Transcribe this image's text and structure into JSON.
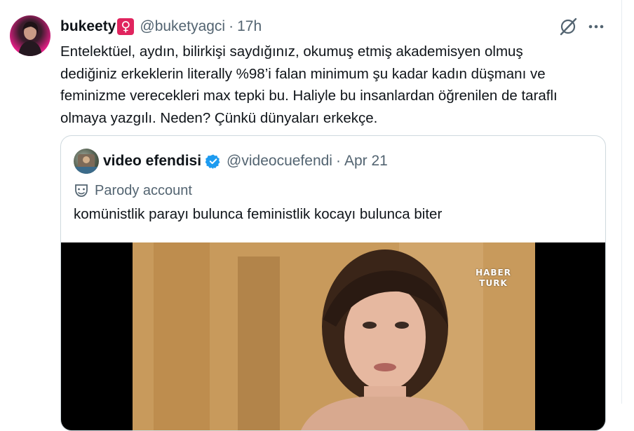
{
  "tweet": {
    "display_name": "bukeety",
    "name_emoji": "♀",
    "handle": "@buketyagci",
    "separator": "·",
    "time": "17h",
    "text": "Entelektüel, aydın, bilirkişi saydığınız, okumuş etmiş akademisyen olmuş\ndediğiniz erkeklerin literally %98’i falan minimum şu kadar kadın düşmanı ve\nfeminizme verecekleri max tepki bu. Haliyle bu insanlardan öğrenilen de taraflı\nolmaya yazgılı. Neden? Çünkü dünyaları erkekçe."
  },
  "actions": {
    "grok_icon": "grok-icon",
    "more_icon": "more-options-icon"
  },
  "quote": {
    "display_name": "video efendisi",
    "handle": "@videocuefendi",
    "separator": "·",
    "time": "Apr 21",
    "parody_label": "Parody account",
    "text": "komünistlik parayı bulunca feministlik kocayı bulunca biter",
    "video_logo_top": "HABER",
    "video_logo_bottom": "TURK"
  },
  "colors": {
    "text_primary": "#0f1419",
    "text_secondary": "#536471",
    "border": "#cfd9de",
    "verified": "#1d9bf0",
    "badge": "#e0245e"
  }
}
